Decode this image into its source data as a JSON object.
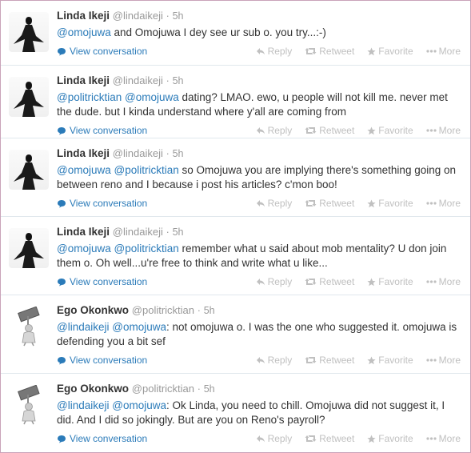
{
  "actions": {
    "reply": "Reply",
    "retweet": "Retweet",
    "favorite": "Favorite",
    "more": "More",
    "view_conversation": "View conversation"
  },
  "tweets": [
    {
      "name": "Linda Ikeji",
      "handle": "@lindaikeji",
      "dot": "·",
      "time": "5h",
      "mentions": [
        "@omojuwa"
      ],
      "text": " and Omojuwa I dey see ur sub o. you try...:-)"
    },
    {
      "name": "Linda Ikeji",
      "handle": "@lindaikeji",
      "dot": "·",
      "time": "5h",
      "mentions": [
        "@politricktian",
        "@omojuwa"
      ],
      "text": " dating? LMAO. ewo, u people will not kill me. never met the dude. but I kinda understand where y'all are coming from"
    },
    {
      "name": "Linda Ikeji",
      "handle": "@lindaikeji",
      "dot": "·",
      "time": "5h",
      "mentions": [
        "@omojuwa",
        "@politricktian"
      ],
      "text": " so Omojuwa you are implying there's something going on between reno and I because i post his articles? c'mon boo!"
    },
    {
      "name": "Linda Ikeji",
      "handle": "@lindaikeji",
      "dot": "·",
      "time": "5h",
      "mentions": [
        "@omojuwa",
        "@politricktian"
      ],
      "text": " remember what u said about mob mentality? U don join them o. Oh well...u're free to think and write what u like..."
    },
    {
      "name": "Ego Okonkwo",
      "handle": "@politricktian",
      "dot": "·",
      "time": "5h",
      "mentions": [
        "@lindaikeji",
        "@omojuwa"
      ],
      "text": ": not omojuwa o. I was the one who suggested it. omojuwa is defending you a bit sef"
    },
    {
      "name": "Ego Okonkwo",
      "handle": "@politricktian",
      "dot": "·",
      "time": "5h",
      "mentions": [
        "@lindaikeji",
        "@omojuwa"
      ],
      "text": ": Ok Linda, you need to chill. Omojuwa did not suggest it, I did. And I did so jokingly. But are you on Reno's payroll?"
    }
  ]
}
